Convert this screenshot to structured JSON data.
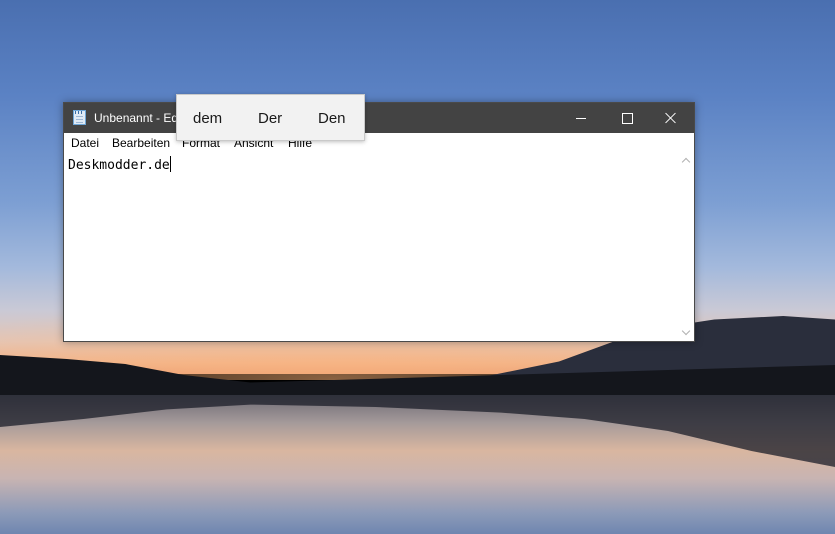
{
  "window": {
    "title": "Unbenannt - Ed",
    "icon": "notepad-icon",
    "controls": {
      "minimize_icon": "minimize-icon",
      "maximize_icon": "maximize-icon",
      "close_icon": "close-icon"
    }
  },
  "menubar": {
    "items": [
      {
        "label": "Datei"
      },
      {
        "label": "Bearbeiten"
      },
      {
        "label": "Format"
      },
      {
        "label": "Ansicht"
      },
      {
        "label": "Hilfe"
      }
    ]
  },
  "editor": {
    "text": "Deskmodder.de"
  },
  "scrollbar": {
    "up_icon": "chevron-up-icon",
    "down_icon": "chevron-down-icon"
  },
  "suggestions": {
    "items": [
      {
        "label": "dem"
      },
      {
        "label": "Der"
      },
      {
        "label": "Den"
      }
    ]
  },
  "colors": {
    "titlebar": "#434343",
    "suggestion_bg": "#f2f2f2"
  }
}
